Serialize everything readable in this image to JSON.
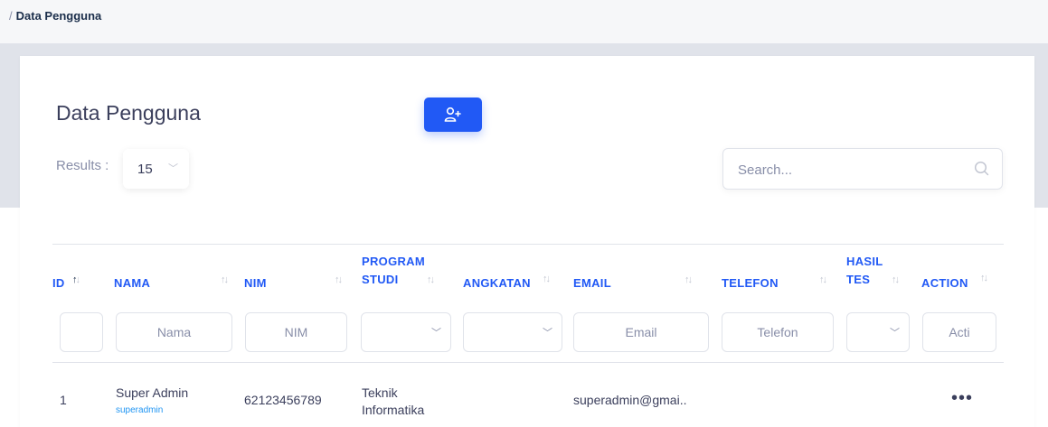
{
  "breadcrumb": {
    "separator": "/",
    "current": "Data Pengguna"
  },
  "page": {
    "title": "Data Pengguna"
  },
  "toolbar": {
    "add_user_icon": "user-plus-icon"
  },
  "results": {
    "label": "Results :",
    "value": "15"
  },
  "search": {
    "placeholder": "Search..."
  },
  "table": {
    "columns": [
      {
        "key": "id",
        "line1": "ID",
        "line2": ""
      },
      {
        "key": "nama",
        "line1": "NAMA",
        "line2": ""
      },
      {
        "key": "nim",
        "line1": "NIM",
        "line2": ""
      },
      {
        "key": "program_studi",
        "line1": "PROGRAM",
        "line2": "STUDI"
      },
      {
        "key": "angkatan",
        "line1": "ANGKATAN",
        "line2": ""
      },
      {
        "key": "email",
        "line1": "EMAIL",
        "line2": ""
      },
      {
        "key": "telefon",
        "line1": "TELEFON",
        "line2": ""
      },
      {
        "key": "hasil_tes",
        "line1": "HASIL",
        "line2": "TES"
      },
      {
        "key": "action",
        "line1": "ACTION",
        "line2": ""
      }
    ],
    "filters": {
      "id": "",
      "nama": "Nama",
      "nim": "NIM",
      "program_studi": "",
      "angkatan": "",
      "email": "Email",
      "telefon": "Telefon",
      "hasil_tes": "",
      "action": "Acti"
    },
    "rows": [
      {
        "id": "1",
        "nama": "Super Admin",
        "username": "superadmin",
        "nim": "62123456789",
        "program_studi_1": "Teknik",
        "program_studi_2": "Informatika",
        "angkatan": "",
        "email": "superadmin@gmai..",
        "telefon": "",
        "hasil_tes": "",
        "action": "•••"
      }
    ]
  },
  "colors": {
    "accent": "#2159f5",
    "text": "#3b3f5c",
    "muted": "#888ea8",
    "link": "#2196f3"
  }
}
